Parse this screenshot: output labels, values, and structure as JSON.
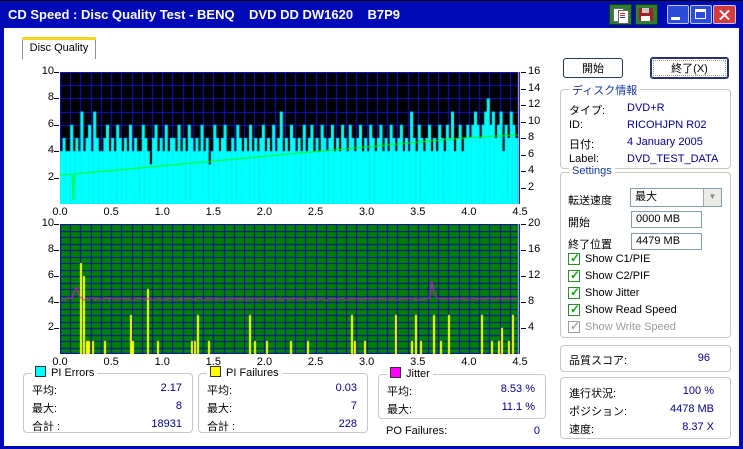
{
  "window": {
    "title": "CD Speed : Disc Quality Test - BENQ    DVD DD DW1620    B7P9"
  },
  "tab": {
    "label": "Disc Quality"
  },
  "buttons": {
    "start": "開始",
    "exit": "終了(X)"
  },
  "disc_info": {
    "caption": "ディスク情報",
    "rows": [
      {
        "label": "タイプ:",
        "value": "DVD+R"
      },
      {
        "label": "ID:",
        "value": "RICOHJPN R02"
      },
      {
        "label": "日付:",
        "value": "4 January 2005"
      },
      {
        "label": "Label:",
        "value": "DVD_TEST_DATA"
      }
    ]
  },
  "settings": {
    "caption": "Settings",
    "transfer_label": "転送速度",
    "transfer_value": "最大",
    "start_label": "開始",
    "start_value": "0000 MB",
    "end_label": "終了位置",
    "end_value": "4479 MB",
    "checkboxes": [
      {
        "label": "Show C1/PIE",
        "checked": true,
        "enabled": true
      },
      {
        "label": "Show C2/PIF",
        "checked": true,
        "enabled": true
      },
      {
        "label": "Show Jitter",
        "checked": true,
        "enabled": true
      },
      {
        "label": "Show Read Speed",
        "checked": true,
        "enabled": true
      },
      {
        "label": "Show Write Speed",
        "checked": true,
        "enabled": false
      }
    ]
  },
  "quality": {
    "label": "品質スコア:",
    "value": "96"
  },
  "progress": {
    "rows": [
      {
        "label": "進行状況:",
        "value": "100 %"
      },
      {
        "label": "ポジション:",
        "value": "4478 MB"
      },
      {
        "label": "速度:",
        "value": "8.37 X"
      }
    ]
  },
  "stats": {
    "pi_errors": {
      "caption": "PI Errors",
      "swatch": "#00FFFF",
      "rows": [
        {
          "label": "平均:",
          "value": "2.17"
        },
        {
          "label": "最大:",
          "value": "8"
        },
        {
          "label": "合計 :",
          "value": "18931"
        }
      ]
    },
    "pi_failures": {
      "caption": "PI Failures",
      "swatch": "#FFFF00",
      "rows": [
        {
          "label": "平均:",
          "value": "0.03"
        },
        {
          "label": "最大:",
          "value": "7"
        },
        {
          "label": "合計 :",
          "value": "228"
        }
      ]
    },
    "jitter": {
      "caption": "Jitter",
      "swatch": "#FF00FF",
      "rows": [
        {
          "label": "平均:",
          "value": "8.53 %"
        },
        {
          "label": "最大:",
          "value": "11.1 %"
        }
      ]
    },
    "po_failures": {
      "label": "PO Failures:",
      "value": "0"
    }
  },
  "chart_data": [
    {
      "type": "bar+line",
      "name": "PI Errors and Read Speed",
      "bg": "#000000",
      "grid_color": "#1212C8",
      "cursor_color": "#C8C8C8",
      "cursor_x": 4.478,
      "xlim": [
        0,
        4.5
      ],
      "x_tick_step": 0.5,
      "x_ticks": [
        "0.0",
        "0.5",
        "1.0",
        "1.5",
        "2.0",
        "2.5",
        "3.0",
        "3.5",
        "4.0",
        "4.5"
      ],
      "left_ylim": [
        0,
        10
      ],
      "left_ticks": [
        2,
        4,
        6,
        8,
        10
      ],
      "right_ylim": [
        0,
        16
      ],
      "right_ticks": [
        2,
        4,
        6,
        8,
        10,
        12,
        14,
        16
      ],
      "grid_x_step": 0.1,
      "grid_y_step": 1,
      "bars": {
        "name": "PI Errors",
        "color": "#00FFFF",
        "scale": "left",
        "step": 0.025,
        "heights": [
          4,
          5,
          4,
          4,
          6,
          4,
          5,
          4,
          7,
          4,
          5,
          6,
          4,
          7,
          5,
          4,
          4,
          5,
          6,
          4,
          5,
          4,
          6,
          5,
          4,
          5,
          4,
          6,
          4,
          5,
          4,
          4,
          6,
          5,
          4,
          3,
          5,
          6,
          4,
          5,
          4,
          6,
          4,
          5,
          5,
          4,
          6,
          4,
          5,
          4,
          6,
          5,
          4,
          5,
          4,
          6,
          4,
          5,
          3,
          4,
          6,
          5,
          4,
          5,
          6,
          4,
          4,
          5,
          4,
          6,
          5,
          4,
          5,
          4,
          6,
          4,
          5,
          4,
          5,
          6,
          4,
          5,
          4,
          6,
          4,
          5,
          7,
          4,
          5,
          4,
          6,
          5,
          4,
          5,
          4,
          6,
          4,
          5,
          6,
          4,
          5,
          4,
          6,
          5,
          4,
          5,
          6,
          4,
          5,
          4,
          6,
          5,
          4,
          6,
          5,
          4,
          5,
          6,
          4,
          5,
          4,
          6,
          5,
          4,
          5,
          6,
          4,
          5,
          4,
          6,
          5,
          4,
          5,
          6,
          4,
          5,
          4,
          7,
          5,
          4,
          6,
          5,
          4,
          5,
          6,
          4,
          5,
          4,
          6,
          5,
          4,
          6,
          5,
          7,
          4,
          5,
          6,
          4,
          5,
          6,
          5,
          6,
          7,
          6,
          5,
          6,
          7,
          8,
          6,
          7,
          5,
          6,
          7,
          4,
          6,
          5,
          7,
          6,
          5
        ]
      },
      "line": {
        "name": "Read Speed",
        "color": "#00FF00",
        "scale": "right",
        "points": [
          [
            0,
            3.5
          ],
          [
            0.1,
            3.6
          ],
          [
            0.12,
            3.62
          ],
          [
            0.13,
            0.5
          ],
          [
            0.14,
            3.65
          ],
          [
            0.5,
            4.05
          ],
          [
            1.0,
            4.62
          ],
          [
            1.5,
            5.2
          ],
          [
            2.0,
            5.78
          ],
          [
            2.5,
            6.35
          ],
          [
            3.0,
            6.92
          ],
          [
            3.5,
            7.5
          ],
          [
            4.0,
            8.05
          ],
          [
            4.478,
            8.37
          ]
        ]
      }
    },
    {
      "type": "bar+line",
      "name": "PI Failures and Jitter",
      "bg": "#008000",
      "grid_color": "#0A0AB0",
      "cursor_color": "#C8C8C8",
      "cursor_x": 4.478,
      "xlim": [
        0,
        4.5
      ],
      "x_tick_step": 0.5,
      "x_ticks": [
        "0.0",
        "0.5",
        "1.0",
        "1.5",
        "2.0",
        "2.5",
        "3.0",
        "3.5",
        "4.0",
        "4.5"
      ],
      "left_ylim": [
        0,
        10
      ],
      "left_ticks": [
        2,
        4,
        6,
        8,
        10
      ],
      "right_ylim": [
        0,
        20
      ],
      "right_ticks": [
        4,
        8,
        12,
        16,
        20
      ],
      "grid_x_step": 0.1,
      "grid_y_step": 0.5,
      "bars": {
        "name": "PI Failures",
        "color": "#FFFF00",
        "scale": "left",
        "positions": [
          [
            0.195,
            7
          ],
          [
            0.225,
            6
          ],
          [
            0.25,
            1
          ],
          [
            0.275,
            1
          ],
          [
            0.31,
            1
          ],
          [
            0.43,
            1
          ],
          [
            0.68,
            3
          ],
          [
            0.7,
            1
          ],
          [
            0.85,
            5
          ],
          [
            0.95,
            1
          ],
          [
            1.28,
            1
          ],
          [
            1.31,
            1
          ],
          [
            1.34,
            3
          ],
          [
            1.45,
            1
          ],
          [
            1.85,
            3
          ],
          [
            1.9,
            1
          ],
          [
            2.02,
            1
          ],
          [
            2.25,
            1
          ],
          [
            2.42,
            1
          ],
          [
            2.85,
            3
          ],
          [
            2.88,
            1
          ],
          [
            2.97,
            1
          ],
          [
            3.28,
            3
          ],
          [
            3.43,
            1
          ],
          [
            3.47,
            3
          ],
          [
            3.52,
            1
          ],
          [
            3.65,
            3
          ],
          [
            3.72,
            1
          ],
          [
            3.8,
            3
          ],
          [
            4.12,
            3
          ],
          [
            4.22,
            1
          ],
          [
            4.28,
            1
          ],
          [
            4.31,
            2
          ],
          [
            4.38,
            1
          ],
          [
            4.42,
            3
          ]
        ]
      },
      "line": {
        "name": "Jitter",
        "color": "#FF00FF",
        "scale": "right",
        "step": 0.025,
        "values": [
          8.6,
          8.3,
          8.5,
          8.8,
          8.4,
          9.6,
          10.3,
          9.0,
          8.5,
          8.3,
          8.6,
          8.4,
          8.7,
          8.3,
          8.5,
          8.6,
          8.2,
          8.5,
          8.7,
          8.4,
          8.6,
          8.3,
          8.5,
          8.4,
          8.6,
          8.3,
          8.6,
          8.4,
          8.2,
          8.5,
          8.7,
          8.4,
          8.6,
          8.3,
          8.5,
          8.6,
          8.3,
          8.4,
          8.6,
          8.2,
          8.5,
          8.3,
          8.6,
          8.4,
          8.5,
          8.2,
          8.4,
          8.6,
          8.3,
          8.5,
          8.4,
          8.6,
          8.3,
          8.5,
          8.7,
          8.4,
          8.2,
          8.5,
          8.6,
          8.3,
          8.5,
          8.4,
          8.6,
          8.2,
          8.4,
          8.5,
          8.3,
          8.6,
          8.4,
          8.5,
          8.3,
          8.6,
          8.4,
          8.2,
          8.5,
          8.6,
          8.4,
          8.3,
          8.5,
          8.6,
          8.4,
          8.5,
          8.3,
          8.6,
          8.4,
          8.5,
          8.2,
          8.4,
          8.6,
          8.3,
          8.5,
          8.4,
          8.6,
          8.3,
          8.5,
          8.4,
          8.2,
          8.6,
          8.4,
          8.5,
          8.3,
          8.5,
          8.6,
          8.4,
          8.2,
          8.5,
          8.4,
          8.6,
          8.3,
          8.5,
          8.6,
          8.4,
          8.3,
          8.5,
          8.6,
          8.4,
          8.5,
          8.3,
          8.4,
          8.6,
          8.5,
          8.3,
          8.6,
          8.4,
          8.5,
          8.4,
          8.6,
          8.3,
          8.5,
          8.4,
          8.6,
          8.2,
          8.5,
          8.3,
          8.6,
          8.4,
          8.5,
          8.6,
          8.3,
          8.5,
          8.4,
          8.2,
          8.6,
          8.4,
          8.5,
          11.1,
          9.2,
          8.6,
          8.4,
          8.5,
          8.6,
          8.4,
          8.5,
          8.3,
          8.6,
          8.4,
          8.5,
          8.6,
          8.3,
          8.5,
          8.4,
          8.6,
          8.5,
          8.3,
          8.6,
          8.4,
          8.5,
          8.6,
          8.4,
          8.5,
          8.3,
          8.6,
          8.5,
          8.4,
          8.5,
          8.6,
          8.4,
          8.5,
          8.6
        ]
      }
    }
  ]
}
